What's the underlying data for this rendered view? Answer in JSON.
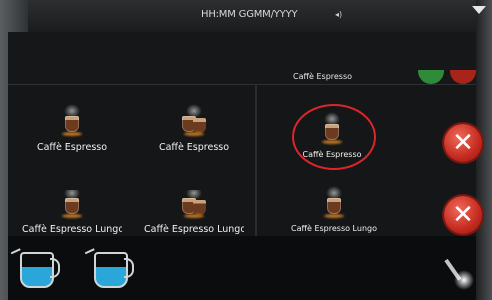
{
  "status": {
    "datetime": "HH:MM GGMM/YYYY",
    "volume_icon": "speaker-icon"
  },
  "drinks": [
    {
      "label": "Caffè Espresso",
      "icon": "espresso-cup-icon"
    },
    {
      "label": "Caffè Espresso",
      "icon": "double-espresso-cup-icon"
    },
    {
      "label": "Caffè Espresso",
      "icon": "espresso-cup-icon",
      "selected": true
    },
    {
      "label": "Caffè Espresso Lungo",
      "icon": "lungo-cup-icon"
    },
    {
      "label": "Caffè Espresso Lungo",
      "icon": "double-lungo-cup-icon"
    },
    {
      "label": "Caffè Espresso Lungo",
      "icon": "lungo-cup-icon"
    }
  ],
  "partial_top_label": "Caffè Espresso",
  "cancel_buttons": [
    {
      "symbol": "✕",
      "icon": "cancel-icon"
    },
    {
      "symbol": "✕",
      "icon": "cancel-icon"
    }
  ],
  "colors": {
    "accent_red": "#d9262a",
    "milk_blue": "#2aa6d8",
    "background": "#0e0f10"
  }
}
